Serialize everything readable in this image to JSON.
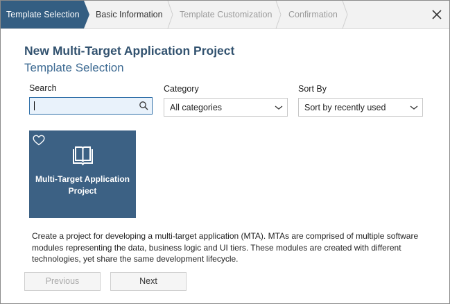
{
  "wizard": {
    "steps": [
      {
        "label": "Template Selection",
        "state": "active"
      },
      {
        "label": "Basic Information",
        "state": "enabled"
      },
      {
        "label": "Template Customization",
        "state": "disabled"
      },
      {
        "label": "Confirmation",
        "state": "disabled"
      }
    ],
    "close_icon": "close-icon"
  },
  "header": {
    "title": "New Multi-Target Application Project",
    "subtitle": "Template Selection"
  },
  "filters": {
    "search": {
      "label": "Search",
      "value": "",
      "placeholder": "",
      "icon": "search-icon"
    },
    "category": {
      "label": "Category",
      "selected": "All categories"
    },
    "sort": {
      "label": "Sort By",
      "selected": "Sort by recently used"
    }
  },
  "templates": [
    {
      "name": "Multi-Target Application Project",
      "icon": "book-icon",
      "favorite_icon": "heart-icon",
      "selected": true
    }
  ],
  "description": "Create a project for developing a multi-target application (MTA). MTAs are comprised of multiple software modules representing the data, business logic and UI tiers. These modules are created with different technologies, yet share the same development lifecycle.",
  "buttons": {
    "previous": "Previous",
    "next": "Next"
  },
  "colors": {
    "accent": "#345e82",
    "tile": "#3c6184",
    "title": "#32526f"
  }
}
